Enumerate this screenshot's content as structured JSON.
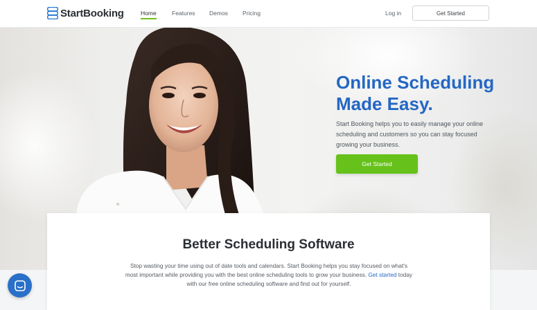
{
  "brand": {
    "name": "StartBooking",
    "logo_icon": "s-logo-icon",
    "accent": "#2467c4",
    "cta_green": "#66c21a"
  },
  "nav": {
    "items": [
      {
        "label": "Home",
        "active": true
      },
      {
        "label": "Features",
        "active": false
      },
      {
        "label": "Demos",
        "active": false
      },
      {
        "label": "Pricing",
        "active": false
      }
    ],
    "login_label": "Log in",
    "cta_label": "Get Started"
  },
  "hero": {
    "title_line1": "Online Scheduling",
    "title_line2": "Made Easy.",
    "description": "Start Booking helps you to easily manage your online scheduling and customers so you can stay focused growing your business.",
    "cta_label": "Get Started"
  },
  "feature": {
    "title": "Better Scheduling Software",
    "text_before": "Stop wasting your time using out of date tools and calendars. Start Booking helps you stay focused on what's most important while providing you with the best online scheduling tools to grow your business.",
    "link_label": "Get started",
    "text_after": "today with our free online scheduling software and find out for yourself."
  },
  "chat": {
    "icon": "chat-icon"
  }
}
